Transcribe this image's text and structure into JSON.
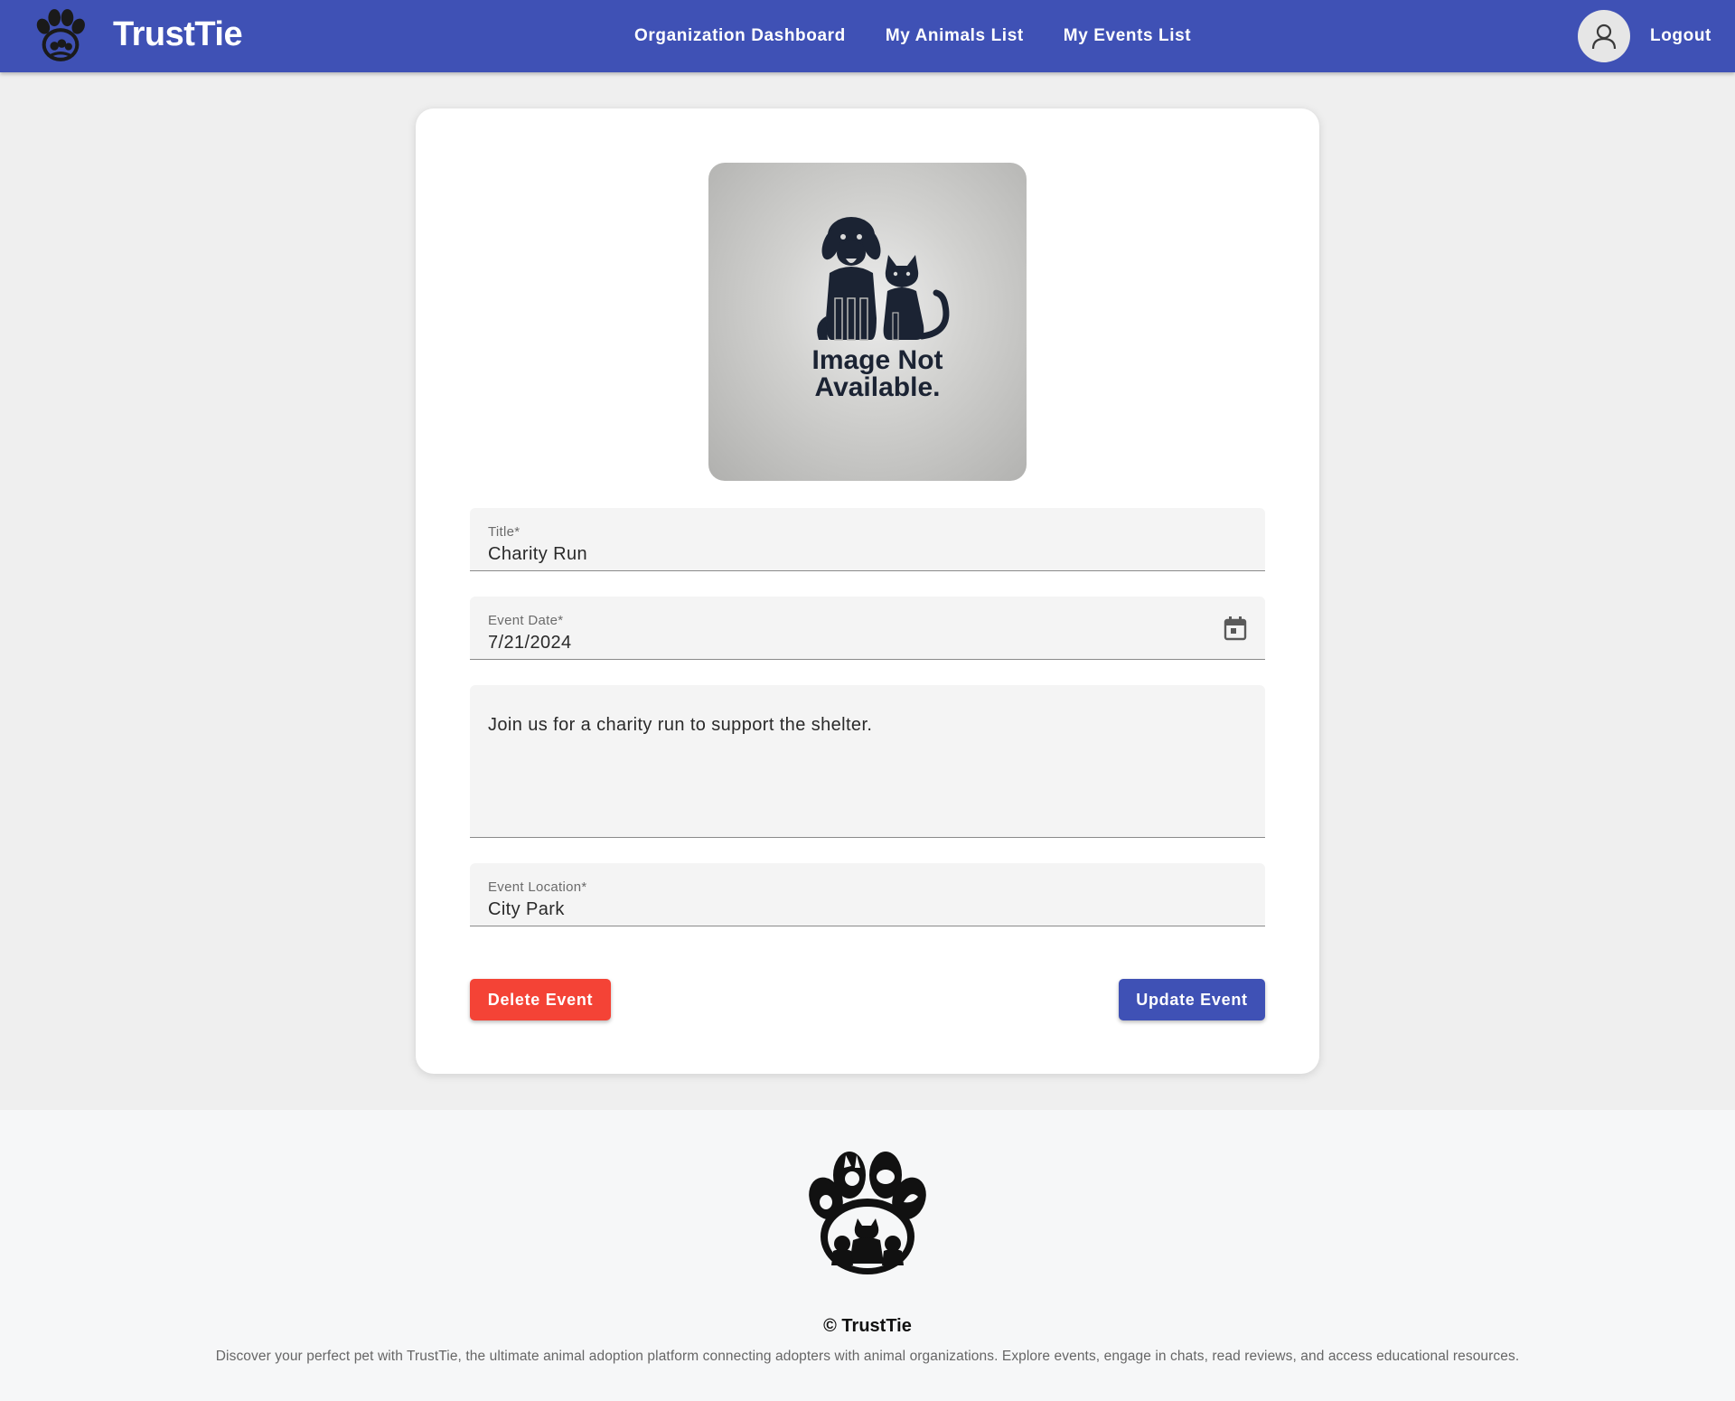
{
  "header": {
    "brand": "TrustTie",
    "nav": [
      {
        "label": "Organization Dashboard"
      },
      {
        "label": "My Animals List"
      },
      {
        "label": "My Events List"
      }
    ],
    "logout_label": "Logout"
  },
  "event_form": {
    "image": {
      "placeholder_line1": "Image Not",
      "placeholder_line2": "Available."
    },
    "title": {
      "label": "Title*",
      "value": "Charity Run"
    },
    "event_date": {
      "label": "Event Date*",
      "value": "7/21/2024"
    },
    "description": {
      "value": "Join us for a charity run to support the shelter."
    },
    "location": {
      "label": "Event Location*",
      "value": "City Park"
    },
    "delete_label": "Delete Event",
    "update_label": "Update Event"
  },
  "footer": {
    "copyright": "© TrustTie",
    "description": "Discover your perfect pet with TrustTie, the ultimate animal adoption platform connecting adopters with animal organizations. Explore events, engage in chats, read reviews, and access educational resources."
  },
  "colors": {
    "primary": "#3f51b5",
    "danger": "#f44336",
    "page_bg": "#efefef",
    "footer_bg": "#f6f7f8"
  },
  "icons": [
    "paw-logo-icon",
    "user-avatar-icon",
    "calendar-icon",
    "dog-cat-icon"
  ]
}
